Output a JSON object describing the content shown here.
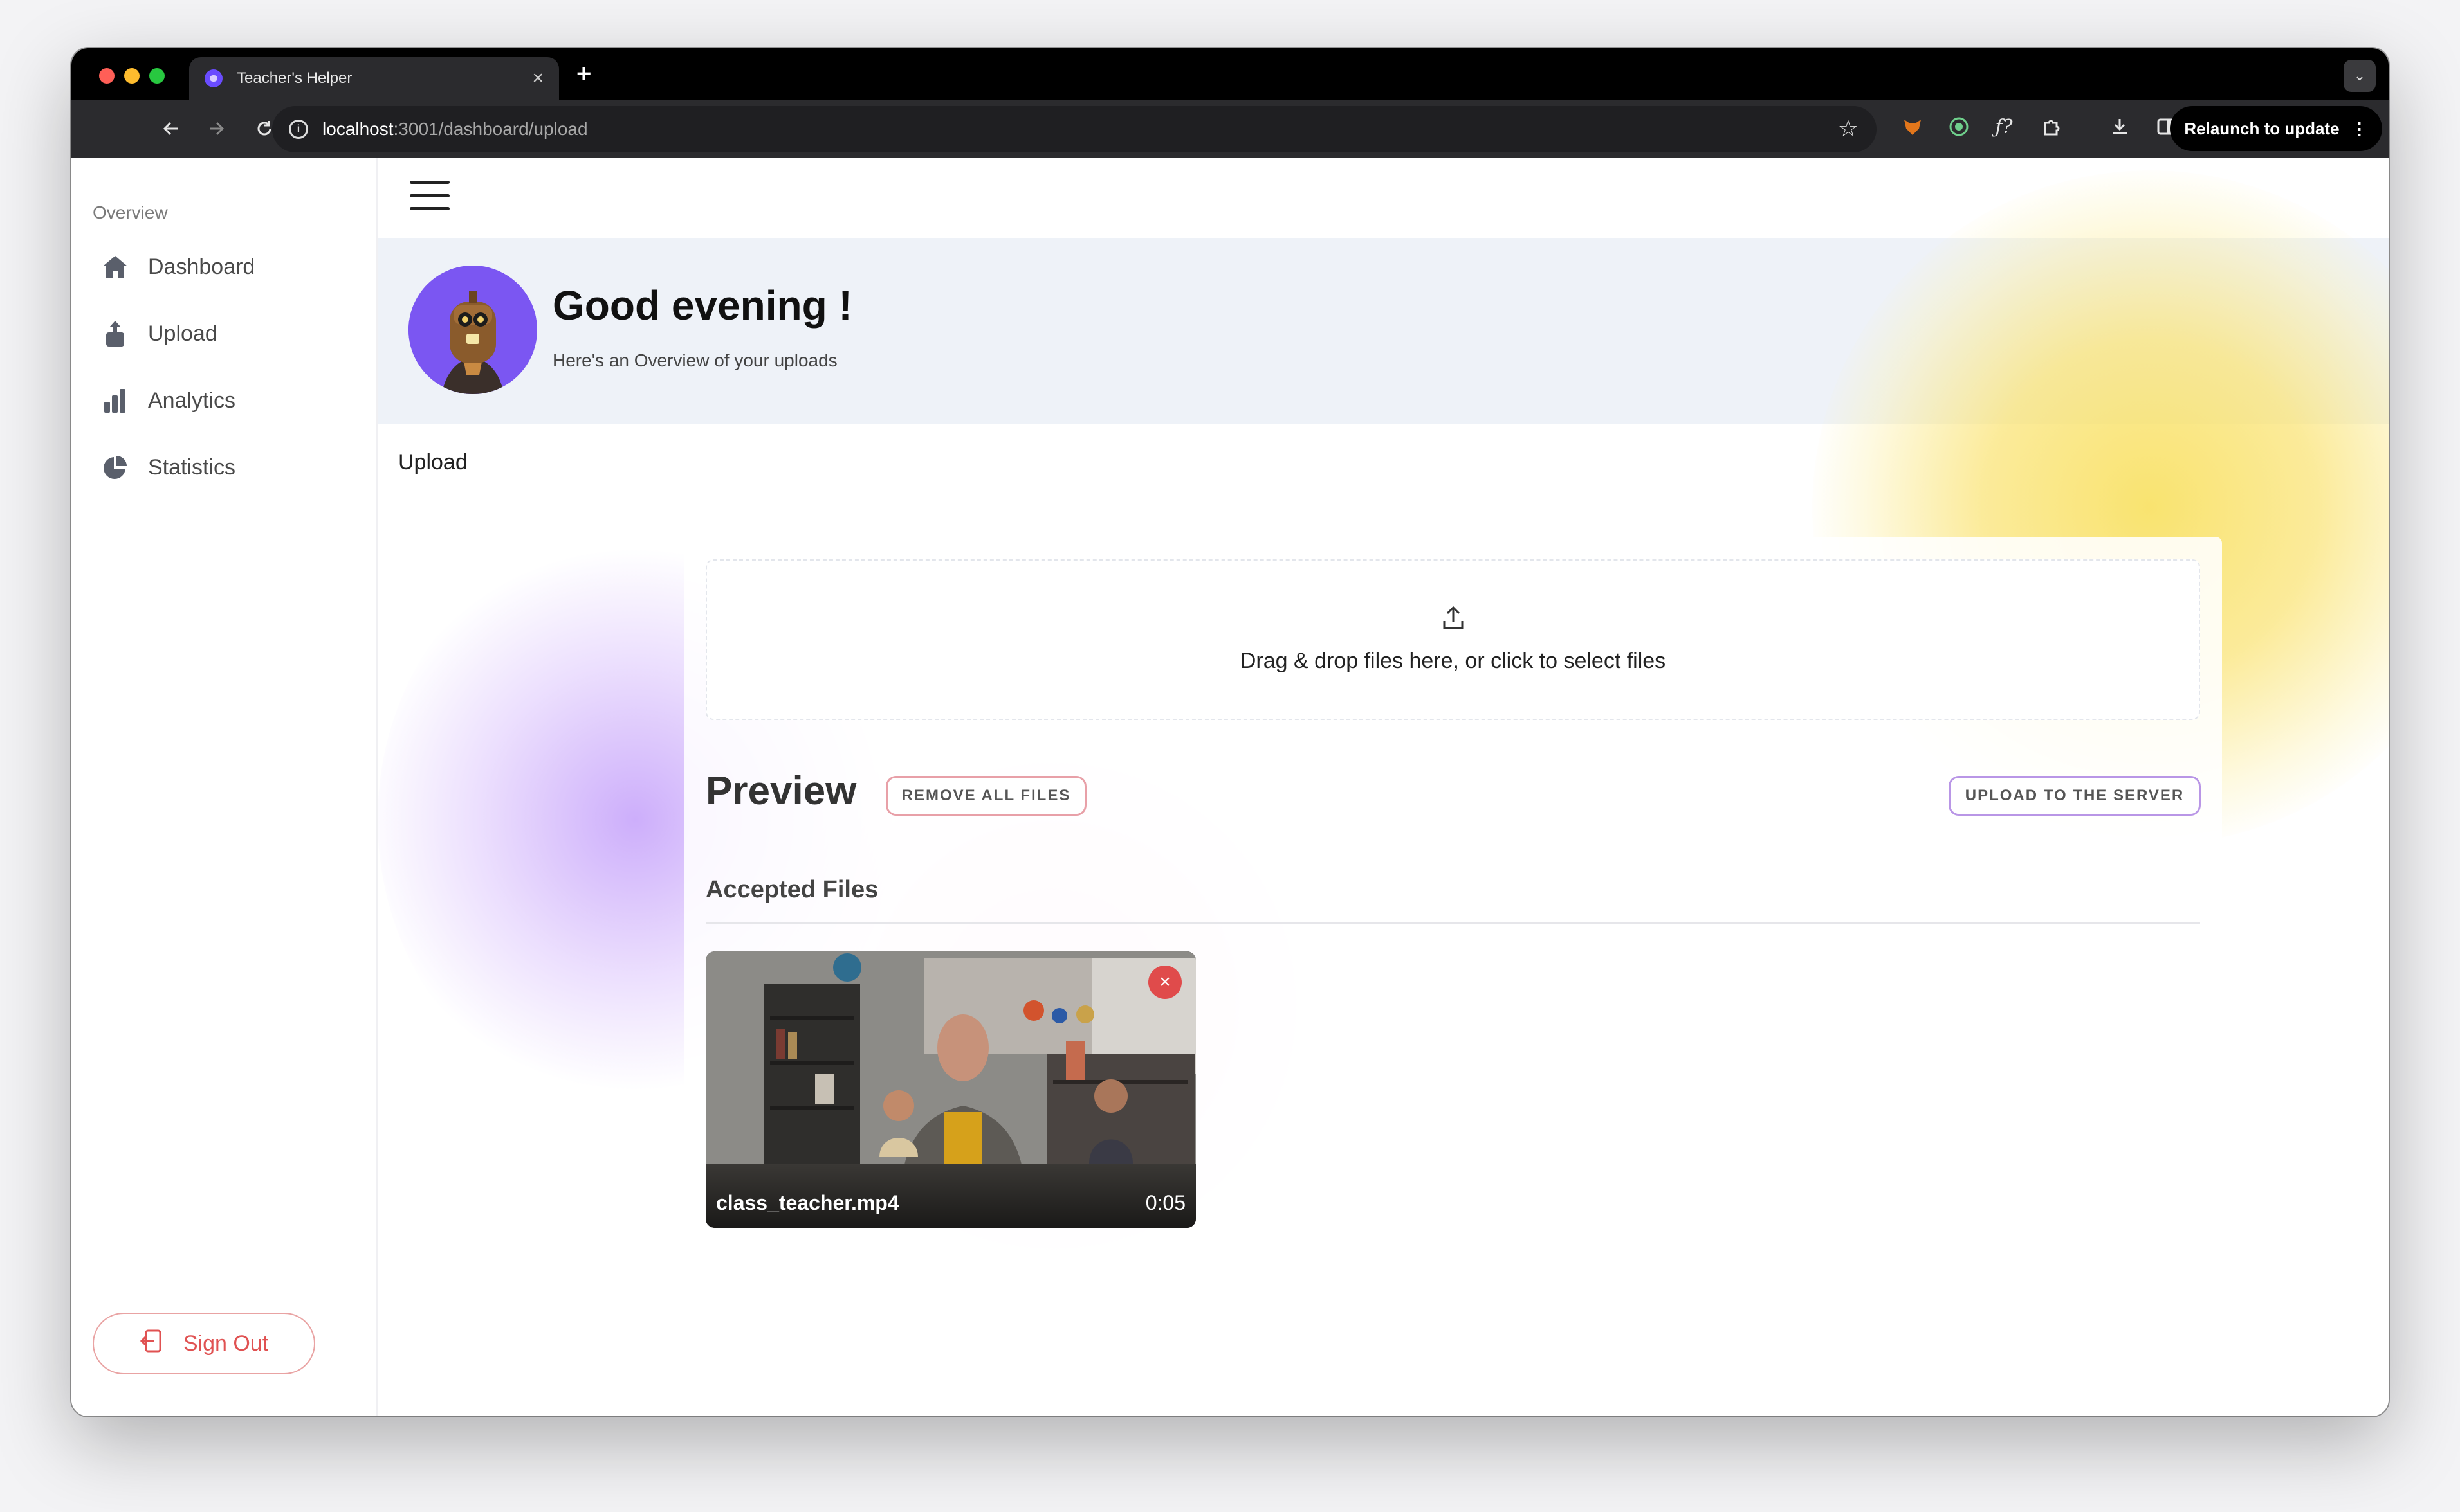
{
  "browser": {
    "tab_title": "Teacher's Helper",
    "tab_close": "×",
    "new_tab": "+",
    "tab_menu": "⌄",
    "url_host": "localhost",
    "url_path": ":3001/dashboard/upload",
    "relaunch_label": "Relaunch to update",
    "relaunch_menu": "⋮"
  },
  "sidebar": {
    "section_label": "Overview",
    "items": [
      {
        "label": "Dashboard",
        "icon": "home-icon"
      },
      {
        "label": "Upload",
        "icon": "upload-icon"
      },
      {
        "label": "Analytics",
        "icon": "bar-chart-icon"
      },
      {
        "label": "Statistics",
        "icon": "pie-chart-icon"
      }
    ],
    "signout_label": "Sign Out"
  },
  "header": {
    "greeting": "Good evening !",
    "subtitle": "Here's an Overview of your uploads"
  },
  "upload": {
    "section_title": "Upload",
    "dropzone_text": "Drag & drop files here, or click to select files",
    "preview_title": "Preview",
    "remove_all_label": "REMOVE ALL FILES",
    "upload_server_label": "UPLOAD TO THE SERVER",
    "accepted_title": "Accepted Files",
    "files": [
      {
        "name": "class_teacher.mp4",
        "duration": "0:05"
      }
    ]
  },
  "colors": {
    "accent_purple": "#7b56f2",
    "signout_red": "#e05252",
    "blob_yellow": "#f8e060"
  }
}
